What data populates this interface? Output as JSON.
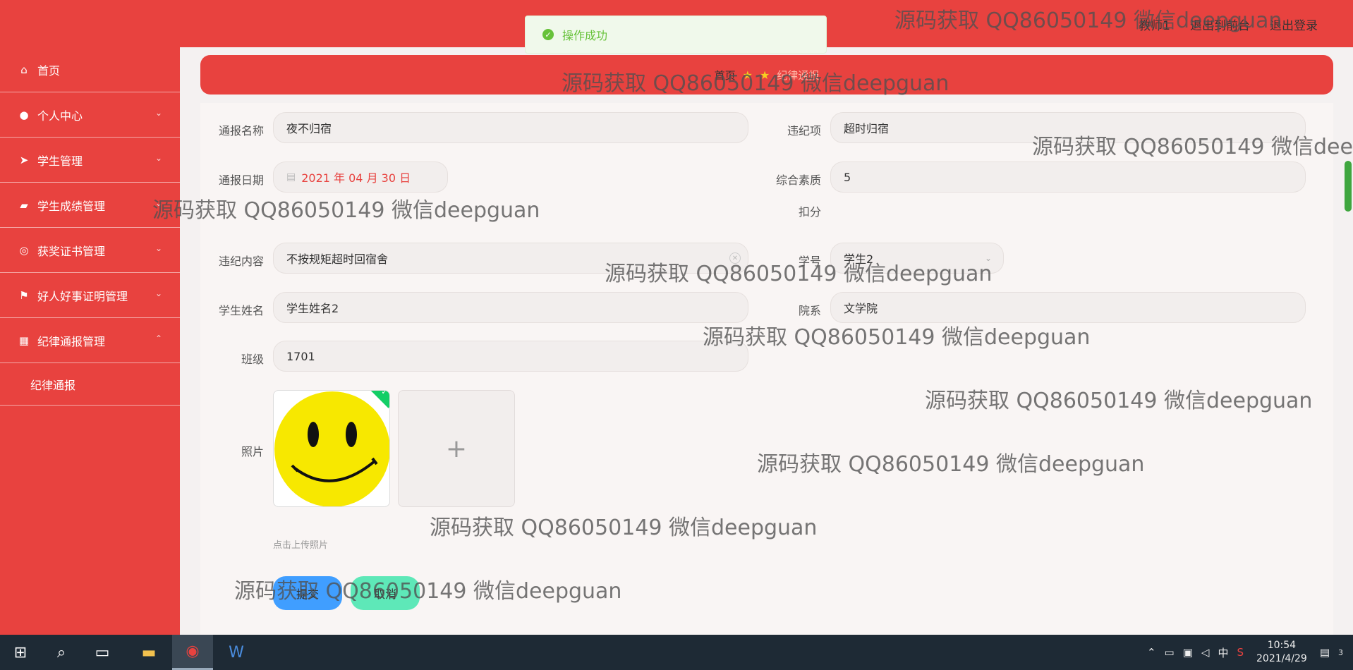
{
  "header": {
    "links": [
      "教师1",
      "退出到前台",
      "退出登录"
    ]
  },
  "toast": {
    "message": "操作成功"
  },
  "sidebar": {
    "items": [
      {
        "label": "首页",
        "icon": "home-icon"
      },
      {
        "label": "个人中心",
        "icon": "user-icon"
      },
      {
        "label": "学生管理",
        "icon": "send-icon"
      },
      {
        "label": "学生成绩管理",
        "icon": "briefcase-icon"
      },
      {
        "label": "获奖证书管理",
        "icon": "globe-icon"
      },
      {
        "label": "好人好事证明管理",
        "icon": "flag-icon"
      },
      {
        "label": "纪律通报管理",
        "icon": "grid-icon"
      }
    ],
    "subitem": "纪律通报"
  },
  "breadcrumb": {
    "home": "首页",
    "current": "纪律通报"
  },
  "form": {
    "name_label": "通报名称",
    "name_value": "夜不归宿",
    "violation_label": "违纪项",
    "violation_value": "超时归宿",
    "date_label": "通报日期",
    "date_value": "2021 年 04 月 30 日",
    "score_label_1": "综合素质",
    "score_label_2": "扣分",
    "score_value": "5",
    "content_label": "违纪内容",
    "content_value": "不按规矩超时回宿舍",
    "student_no_label": "学号",
    "student_no_value": "学生2",
    "student_name_label": "学生姓名",
    "student_name_value": "学生姓名2",
    "dept_label": "院系",
    "dept_value": "文学院",
    "class_label": "班级",
    "class_value": "1701",
    "photo_label": "照片",
    "upload_plus": "+",
    "upload_hint": "点击上传照片",
    "submit_label": "提交",
    "cancel_label": "取消"
  },
  "watermark": "源码获取 QQ86050149 微信deepguan",
  "taskbar": {
    "tray_ime": "中",
    "time": "10:54",
    "date": "2021/4/29",
    "notification_count": "3"
  },
  "colors": {
    "primary": "#e8423f",
    "submit": "#409eff",
    "cancel": "#5ee8b8",
    "success": "#67c23a"
  }
}
